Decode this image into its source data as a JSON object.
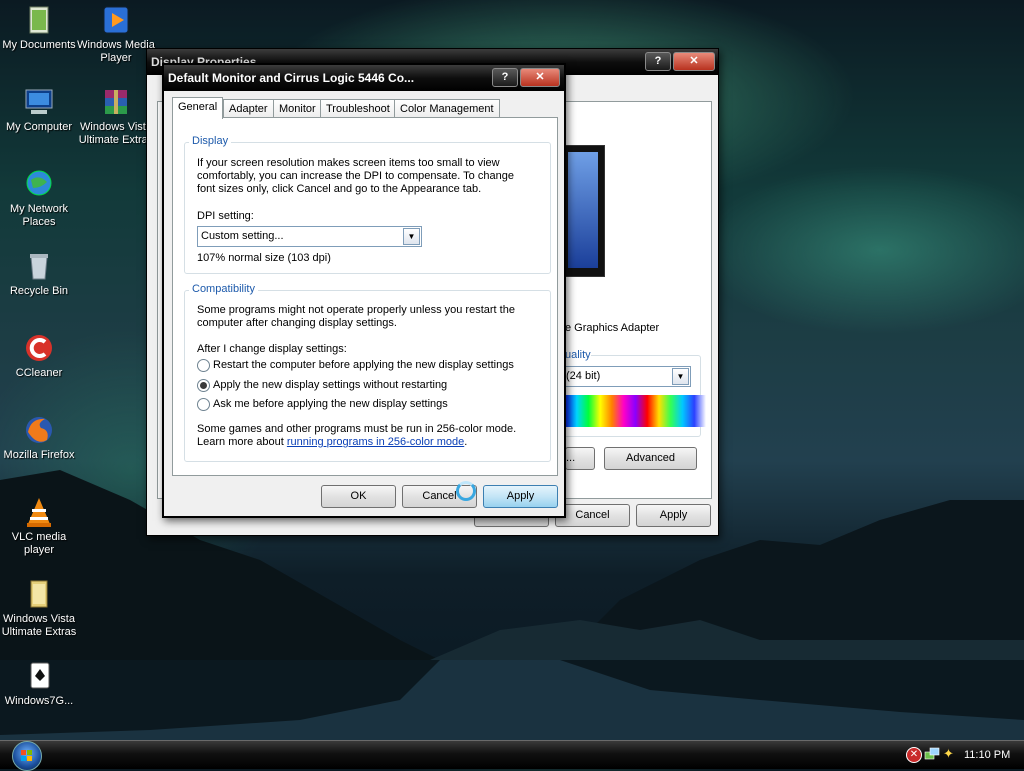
{
  "desktop": {
    "icons": [
      {
        "label": "My Documents",
        "icon": "folder-documents-icon"
      },
      {
        "label": "Windows Media Player",
        "icon": "media-player-icon"
      },
      {
        "label": "My Computer",
        "icon": "computer-icon"
      },
      {
        "label": "Windows Vista Ultimate Extras",
        "icon": "winrar-icon"
      },
      {
        "label": "My Network Places",
        "icon": "network-icon"
      },
      {
        "label": "Recycle Bin",
        "icon": "recycle-bin-icon"
      },
      {
        "label": "CCleaner",
        "icon": "ccleaner-icon"
      },
      {
        "label": "Mozilla Firefox",
        "icon": "firefox-icon"
      },
      {
        "label": "VLC media player",
        "icon": "vlc-icon"
      },
      {
        "label": "Windows Vista Ultimate Extras",
        "icon": "folder-icon"
      },
      {
        "label": "Windows7G...",
        "icon": "solitaire-icon"
      }
    ]
  },
  "back_window": {
    "title": "Display Properties",
    "adapter_text": "e Graphics Adapter",
    "quality_label": "uality",
    "color_value": "(24 bit)",
    "dots_button": "...",
    "advanced_button": "Advanced",
    "ok_button": "OK",
    "cancel_button": "Cancel",
    "apply_button": "Apply",
    "help_glyph": "?",
    "close_glyph": "✕"
  },
  "dialog": {
    "title": "Default Monitor and Cirrus Logic 5446 Co...",
    "help_glyph": "?",
    "close_glyph": "✕",
    "tabs": [
      {
        "label": "General",
        "active": true
      },
      {
        "label": "Adapter",
        "active": false
      },
      {
        "label": "Monitor",
        "active": false
      },
      {
        "label": "Troubleshoot",
        "active": false
      },
      {
        "label": "Color Management",
        "active": false
      }
    ],
    "display_group": {
      "legend": "Display",
      "desc_lines": [
        "If your screen resolution makes screen items too small to view",
        "comfortably, you can increase the DPI to compensate.  To change",
        "font sizes only, click Cancel and go to the Appearance tab."
      ],
      "dpi_label": "DPI setting:",
      "dpi_value": "Custom setting...",
      "dpi_size": "107% normal size (103 dpi)"
    },
    "compat_group": {
      "legend": "Compatibility",
      "desc_lines": [
        "Some programs might not operate properly unless you restart the",
        "computer after changing display settings."
      ],
      "after_label": "After I change display settings:",
      "options": [
        {
          "label": "Restart the computer before applying the new display settings",
          "selected": false
        },
        {
          "label": "Apply the new display settings without restarting",
          "selected": true
        },
        {
          "label": "Ask me before applying the new display settings",
          "selected": false
        }
      ],
      "note_line1": "Some games and other programs must be run in 256-color mode.",
      "note_prefix": "Learn more about ",
      "note_link": "running programs in 256-color mode",
      "note_suffix": "."
    },
    "ok_button": "OK",
    "cancel_button": "Cancel",
    "apply_button": "Apply"
  },
  "taskbar": {
    "start_icon": "windows-start-orb-icon",
    "tray_icons": [
      "security-alert-icon",
      "network-icon",
      "cleanup-wizard-icon"
    ],
    "clock": "11:10 PM"
  }
}
